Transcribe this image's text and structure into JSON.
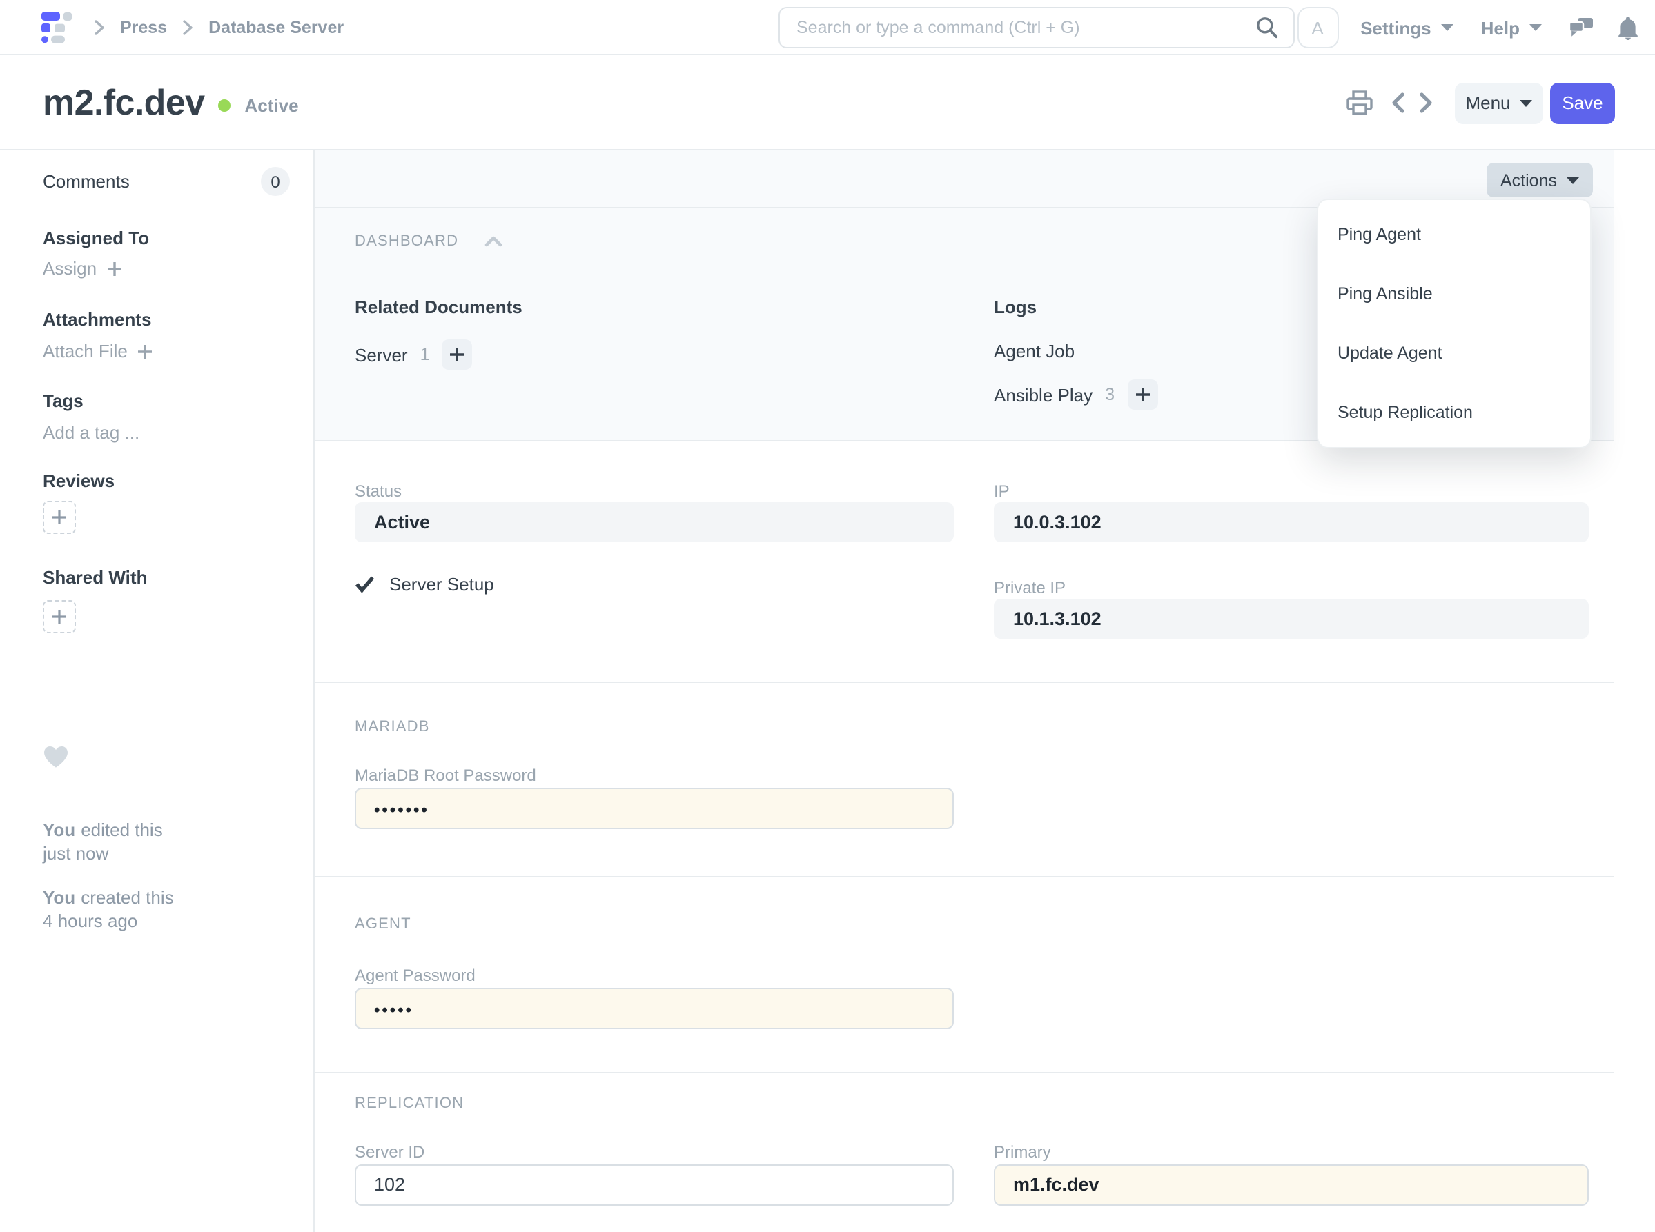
{
  "navbar": {
    "breadcrumbs": [
      "Press",
      "Database Server"
    ],
    "search_placeholder": "Search or type a command (Ctrl + G)",
    "avatar_letter": "A",
    "settings_label": "Settings",
    "help_label": "Help"
  },
  "header": {
    "title": "m2.fc.dev",
    "status_text": "Active",
    "menu_label": "Menu",
    "save_label": "Save"
  },
  "toolbar": {
    "actions_label": "Actions"
  },
  "actions_menu": {
    "items": [
      "Ping Agent",
      "Ping Ansible",
      "Update Agent",
      "Setup Replication"
    ]
  },
  "sidebar": {
    "comments_label": "Comments",
    "comments_count": "0",
    "assigned_to": {
      "heading": "Assigned To",
      "action": "Assign"
    },
    "attachments": {
      "heading": "Attachments",
      "action": "Attach File"
    },
    "tags": {
      "heading": "Tags",
      "action": "Add a tag ..."
    },
    "reviews": {
      "heading": "Reviews"
    },
    "shared_with": {
      "heading": "Shared With"
    },
    "activity": [
      {
        "actor": "You",
        "action": "edited this",
        "when": "just now"
      },
      {
        "actor": "You",
        "action": "created this",
        "when": "4 hours ago"
      }
    ]
  },
  "dashboard": {
    "heading": "DASHBOARD",
    "related_documents": {
      "heading": "Related Documents",
      "links": [
        {
          "label": "Server",
          "count": "1"
        }
      ]
    },
    "logs": {
      "heading": "Logs",
      "links": [
        {
          "label": "Agent Job",
          "count": ""
        },
        {
          "label": "Ansible Play",
          "count": "3"
        }
      ]
    }
  },
  "form": {
    "status": {
      "label": "Status",
      "value": "Active"
    },
    "server_setup": {
      "label": "Server Setup",
      "checked": true
    },
    "ip": {
      "label": "IP",
      "value": "10.0.3.102"
    },
    "private_ip": {
      "label": "Private IP",
      "value": "10.1.3.102"
    },
    "mariadb": {
      "heading": "MARIADB"
    },
    "mariadb_root_password": {
      "label": "MariaDB Root Password",
      "value": "•••••••"
    },
    "agent": {
      "heading": "AGENT"
    },
    "agent_password": {
      "label": "Agent Password",
      "value": "•••••"
    },
    "replication": {
      "heading": "REPLICATION"
    },
    "server_id": {
      "label": "Server ID",
      "value": "102"
    },
    "primary": {
      "label": "Primary",
      "value": "m1.fc.dev"
    }
  },
  "colors": {
    "accent": "#5E64EC",
    "active_green": "#99D957",
    "text_dark": "#36414C",
    "text_muted": "#8D99A6",
    "section_bg": "#F8FAFC",
    "readonly_field_bg": "#F3F5F7",
    "changed_field_bg": "#FDF9ED"
  }
}
